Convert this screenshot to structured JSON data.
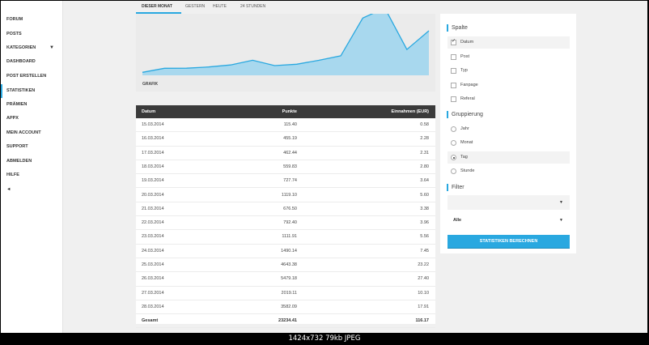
{
  "sidebar": {
    "items": [
      {
        "label": "FORUM"
      },
      {
        "label": "POSTS"
      },
      {
        "label": "KATEGORIEN",
        "chevron": "▼"
      },
      {
        "label": "DASHBOARD"
      },
      {
        "label": "POST ERSTELLEN"
      },
      {
        "label": "STATISTIKEN",
        "active": true
      },
      {
        "label": "PRÄMIEN"
      },
      {
        "label": "APPX"
      },
      {
        "label": "MEIN ACCOUNT"
      },
      {
        "label": "SUPPORT"
      },
      {
        "label": "ABMELDEN"
      },
      {
        "label": "HILFE"
      }
    ],
    "collapse": "◄"
  },
  "tabs": [
    {
      "label": "DIESER MONAT",
      "active": true
    },
    {
      "label": "GESTERN"
    },
    {
      "label": "HEUTE"
    },
    {
      "label": "24 STUNDEN"
    }
  ],
  "chart": {
    "label": "GRAFIK",
    "accent": "#29a8e0",
    "fill": "#a8d8ee",
    "points": [
      115.4,
      455.19,
      462.44,
      559.83,
      727.74,
      1119.1,
      676.5,
      792.4,
      1111.91,
      1490.14,
      4643.38,
      5479.18,
      2019.11,
      3582.09
    ]
  },
  "table": {
    "headers": {
      "date": "Datum",
      "points": "Punkte",
      "earnings": "Einnahmen (EUR)"
    },
    "rows": [
      {
        "date": "15.03.2014",
        "points": "115.40",
        "earnings": "0.58"
      },
      {
        "date": "16.03.2014",
        "points": "455.19",
        "earnings": "2.28"
      },
      {
        "date": "17.03.2014",
        "points": "462.44",
        "earnings": "2.31"
      },
      {
        "date": "18.03.2014",
        "points": "559.83",
        "earnings": "2.80"
      },
      {
        "date": "19.03.2014",
        "points": "727.74",
        "earnings": "3.64"
      },
      {
        "date": "20.03.2014",
        "points": "1119.10",
        "earnings": "5.60"
      },
      {
        "date": "21.03.2014",
        "points": "676.50",
        "earnings": "3.38"
      },
      {
        "date": "22.03.2014",
        "points": "792.40",
        "earnings": "3.96"
      },
      {
        "date": "23.03.2014",
        "points": "1111.91",
        "earnings": "5.56"
      },
      {
        "date": "24.03.2014",
        "points": "1490.14",
        "earnings": "7.45"
      },
      {
        "date": "25.03.2014",
        "points": "4643.38",
        "earnings": "23.22"
      },
      {
        "date": "26.03.2014",
        "points": "5479.18",
        "earnings": "27.40"
      },
      {
        "date": "27.03.2014",
        "points": "2019.11",
        "earnings": "10.10"
      },
      {
        "date": "28.03.2014",
        "points": "3582.09",
        "earnings": "17.91"
      }
    ],
    "total": {
      "label": "Gesamt",
      "points": "23234.41",
      "earnings": "116.17"
    }
  },
  "right": {
    "spalte": {
      "title": "Spalte",
      "options": [
        {
          "label": "Datum",
          "checked": true
        },
        {
          "label": "Post",
          "checked": false
        },
        {
          "label": "Typ",
          "checked": false
        },
        {
          "label": "Fanpage",
          "checked": false
        },
        {
          "label": "Referal",
          "checked": false
        }
      ]
    },
    "gruppierung": {
      "title": "Gruppierung",
      "options": [
        {
          "label": "Jahr",
          "checked": false
        },
        {
          "label": "Monat",
          "checked": false
        },
        {
          "label": "Tag",
          "checked": true
        },
        {
          "label": "Stunde",
          "checked": false
        }
      ]
    },
    "filter": {
      "title": "Filter",
      "select1": "",
      "select2": "Alle",
      "arrow": "▼"
    },
    "button": "STATISTIKEN BERECHNEN"
  },
  "caption": "1424x732  79kb  JPEG"
}
